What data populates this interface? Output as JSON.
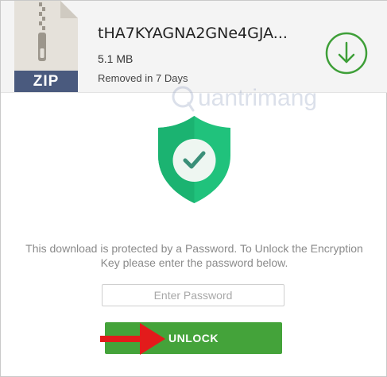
{
  "file": {
    "name": "tHA7KYAGNA2GNe4GJA...",
    "size": "5.1 MB",
    "expiry": "Removed in 7 Days",
    "type_badge": "ZIP",
    "icon": "zip-file-icon"
  },
  "download": {
    "icon": "download-arrow-icon"
  },
  "watermark": {
    "text": "uantrimang",
    "icon": "quantrimang-logo-icon"
  },
  "security": {
    "icon": "shield-check-icon"
  },
  "message": "This download is protected by a Password. To Unlock the Encryption Key please enter the password below.",
  "password_field": {
    "placeholder": "Enter Password",
    "value": ""
  },
  "unlock_button": {
    "label": "UNLOCK"
  },
  "annotation": {
    "icon": "red-arrow-icon"
  },
  "colors": {
    "accent_green": "#44a33a",
    "shield_green": "#20c27c",
    "annotation_red": "#e31b1b",
    "zip_band": "#4a5a7e"
  }
}
